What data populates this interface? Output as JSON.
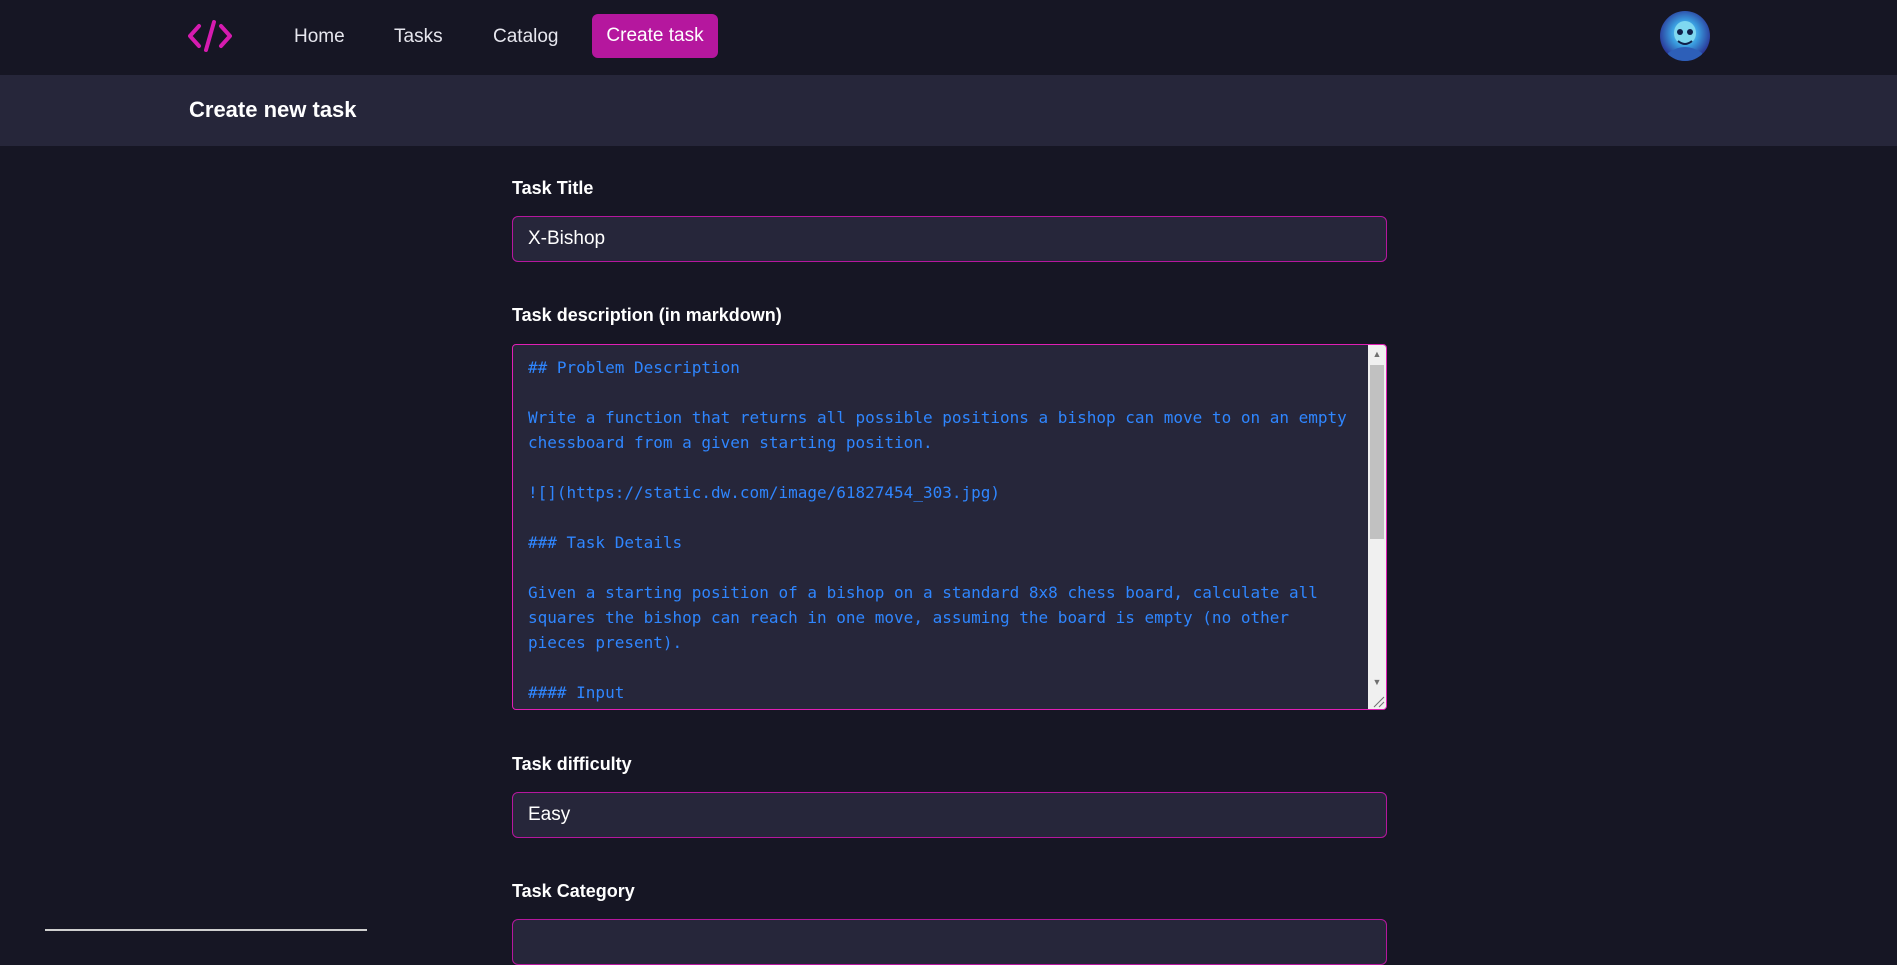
{
  "nav": {
    "logo_icon": "code-brackets-icon",
    "home": "Home",
    "tasks": "Tasks",
    "catalog": "Catalog",
    "create": "Create task"
  },
  "header": {
    "title": "Create new task"
  },
  "form": {
    "title_label": "Task Title",
    "title_value": "X-Bishop",
    "description_label": "Task description (in markdown)",
    "description_value": "## Problem Description\n\nWrite a function that returns all possible positions a bishop can move to on an empty\nchessboard from a given starting position.\n\n![](https://static.dw.com/image/61827454_303.jpg)\n\n### Task Details\n\nGiven a starting position of a bishop on a standard 8x8 chess board, calculate all\nsquares the bishop can reach in one move, assuming the board is empty (no other\npieces present).\n\n#### Input",
    "difficulty_label": "Task difficulty",
    "difficulty_value": "Easy",
    "category_label": "Task Category"
  },
  "colors": {
    "accent": "#b5179e",
    "background": "#161624",
    "panel": "#26263a",
    "code_text": "#2f86ff"
  }
}
